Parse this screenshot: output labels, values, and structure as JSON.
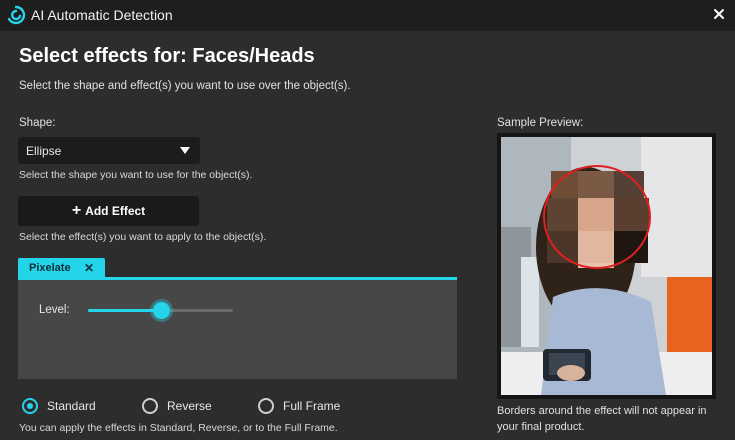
{
  "window": {
    "title": "AI Automatic Detection",
    "icon": "swirl-logo-icon",
    "close_icon": "close-icon"
  },
  "heading": "Select effects for: Faces/Heads",
  "subtitle": "Select the shape and effect(s) you want to use over the object(s).",
  "shape": {
    "label": "Shape:",
    "selected": "Ellipse",
    "hint": "Select the shape you want to use for the object(s)."
  },
  "add_effect": {
    "label": "Add Effect",
    "hint": "Select the effect(s) you want to apply to the object(s)."
  },
  "effect_tab": {
    "label": "Pixelate",
    "close_glyph": "✕"
  },
  "level": {
    "label": "Level:",
    "value_fraction": 0.5
  },
  "modes": [
    {
      "label": "Standard",
      "selected": true
    },
    {
      "label": "Reverse",
      "selected": false
    },
    {
      "label": "Full Frame",
      "selected": false
    }
  ],
  "modes_hint": "You can apply the effects in Standard, Reverse, or to the Full Frame.",
  "preview": {
    "label": "Sample Preview:",
    "note": "Borders around the effect will not appear in your final product."
  },
  "colors": {
    "accent": "#24d4e8",
    "background": "#2d2d2d",
    "titlebar": "#1e1e1e",
    "panel": "#474747",
    "outline_red": "#e02020"
  }
}
